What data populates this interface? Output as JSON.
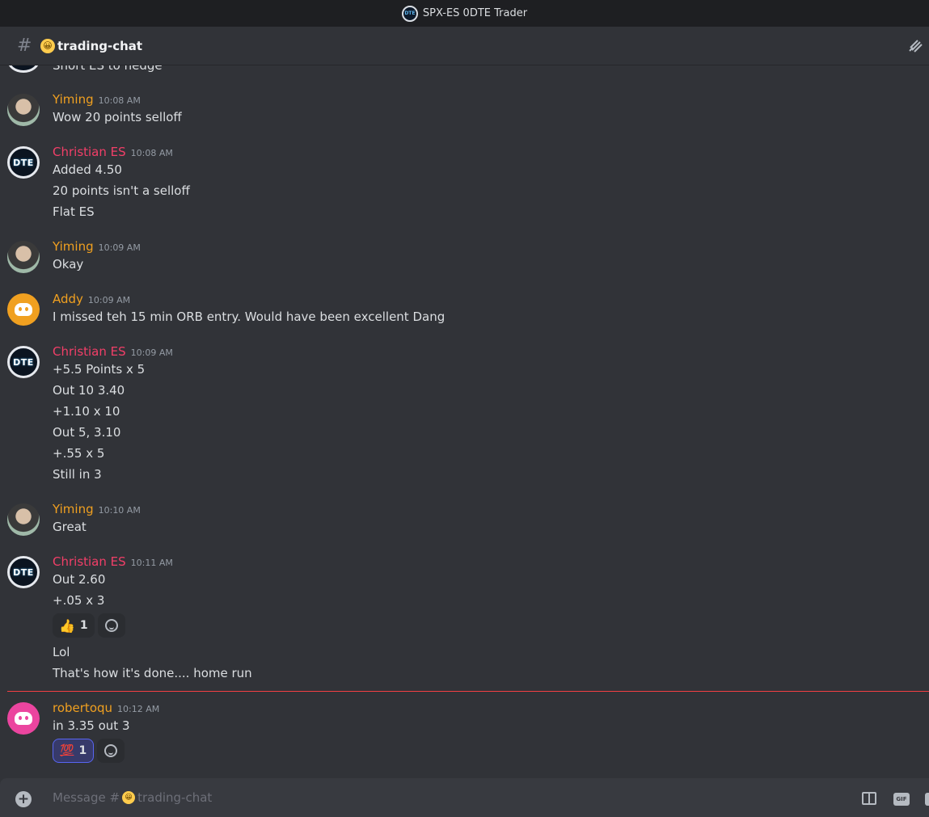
{
  "window": {
    "title": "SPX-ES 0DTE Trader",
    "server_icon_text": "DTE"
  },
  "header": {
    "channel_name": "trading-chat",
    "hash": "#",
    "emoji": "😀"
  },
  "colors": {
    "yiming": "#f0a020",
    "christian": "#f23f68",
    "addy": "#f0a020",
    "robertoqu": "#f0a020"
  },
  "messages": [
    {
      "lines": [
        "Short ES to hedge"
      ]
    },
    {
      "author": "Yiming",
      "time": "10:08 AM",
      "lines": [
        "Wow 20 points selloff"
      ]
    },
    {
      "author": "Christian ES",
      "time": "10:08 AM",
      "avatar_text": "DTE",
      "lines": [
        "Added 4.50",
        "20 points isn't a selloff",
        "Flat ES"
      ]
    },
    {
      "author": "Yiming",
      "time": "10:09 AM",
      "lines": [
        "Okay"
      ]
    },
    {
      "author": "Addy",
      "time": "10:09 AM",
      "lines": [
        "I missed teh 15 min ORB entry.  Would have been excellent Dang"
      ]
    },
    {
      "author": "Christian ES",
      "time": "10:09 AM",
      "avatar_text": "DTE",
      "lines": [
        "+5.5 Points x 5",
        "Out 10 3.40",
        "+1.10 x 10",
        "Out 5, 3.10",
        "+.55 x 5",
        "Still in 3"
      ]
    },
    {
      "author": "Yiming",
      "time": "10:10 AM",
      "lines": [
        "Great"
      ]
    },
    {
      "author": "Christian ES",
      "time": "10:11 AM",
      "avatar_text": "DTE",
      "lines": [
        "Out 2.60",
        "+.05 x 3"
      ],
      "reactions": [
        {
          "emoji": "👍",
          "count": "1"
        }
      ],
      "lines_after": [
        "Lol",
        "That's how it's done.... home run"
      ]
    },
    {
      "author": "robertoqu",
      "time": "10:12 AM",
      "lines": [
        "in 3.35 out 3"
      ],
      "reactions": [
        {
          "emoji": "💯",
          "count": "1"
        }
      ]
    }
  ],
  "composer": {
    "placeholder_prefix": "Message #",
    "placeholder_channel": "trading-chat",
    "emoji": "😀",
    "gif_label": "GIF"
  }
}
